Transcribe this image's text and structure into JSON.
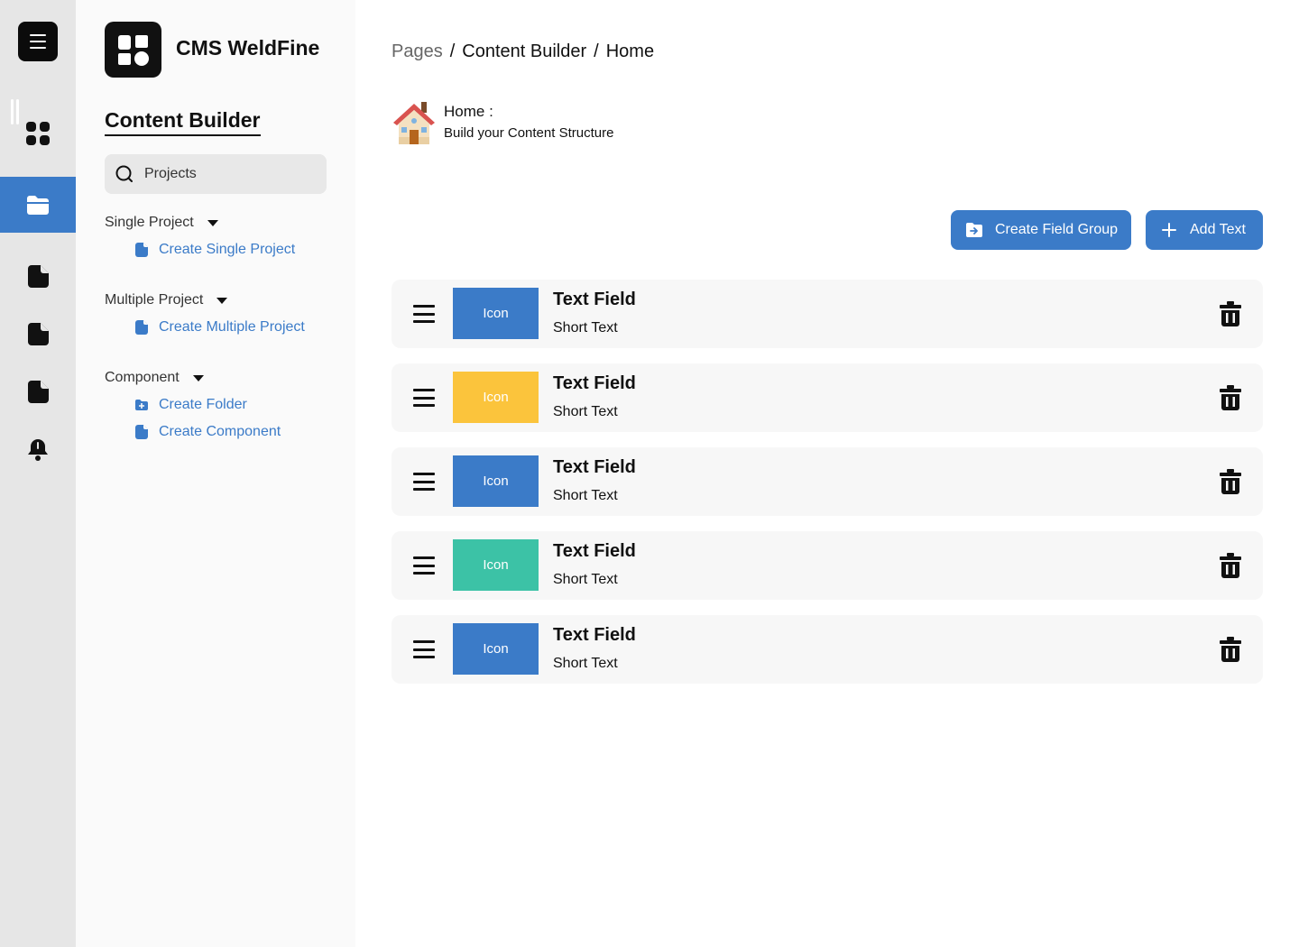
{
  "brand": {
    "name": "CMS WeldFine"
  },
  "colors": {
    "accent": "#3b7bc8",
    "yellow": "#fbc43c",
    "teal": "#3cc2a6"
  },
  "rail": {
    "items": [
      {
        "icon": "grid-icon"
      },
      {
        "icon": "folder-icon",
        "active": true
      },
      {
        "icon": "document-icon"
      },
      {
        "icon": "document-icon"
      },
      {
        "icon": "document-icon"
      },
      {
        "icon": "bell-icon"
      }
    ]
  },
  "sidebar": {
    "title": "Content Builder",
    "search": {
      "placeholder": "Projects"
    },
    "groups": [
      {
        "label": "Single Project",
        "items": [
          {
            "label": "Create Single Project",
            "icon": "document-icon"
          }
        ]
      },
      {
        "label": "Multiple Project",
        "items": [
          {
            "label": "Create Multiple Project",
            "icon": "document-icon"
          }
        ]
      },
      {
        "label": "Component",
        "items": [
          {
            "label": "Create Folder",
            "icon": "folder-plus-icon"
          },
          {
            "label": "Create Component",
            "icon": "document-icon"
          }
        ]
      }
    ]
  },
  "breadcrumb": {
    "items": [
      "Pages",
      "Content Builder",
      "Home"
    ],
    "separator": "/"
  },
  "page": {
    "icon": "house-icon",
    "title": "Home :",
    "subtitle": "Build your Content Structure"
  },
  "actions": {
    "create_field_group": "Create Field Group",
    "add_text": "Add Text"
  },
  "fields": [
    {
      "tile": "Icon",
      "tile_color": "#3b7bc8",
      "title": "Text Field",
      "type": "Short Text"
    },
    {
      "tile": "Icon",
      "tile_color": "#fbc43c",
      "title": "Text Field",
      "type": "Short Text"
    },
    {
      "tile": "Icon",
      "tile_color": "#3b7bc8",
      "title": "Text Field",
      "type": "Short Text"
    },
    {
      "tile": "Icon",
      "tile_color": "#3cc2a6",
      "title": "Text Field",
      "type": "Short Text"
    },
    {
      "tile": "Icon",
      "tile_color": "#3b7bc8",
      "title": "Text Field",
      "type": "Short Text"
    }
  ]
}
